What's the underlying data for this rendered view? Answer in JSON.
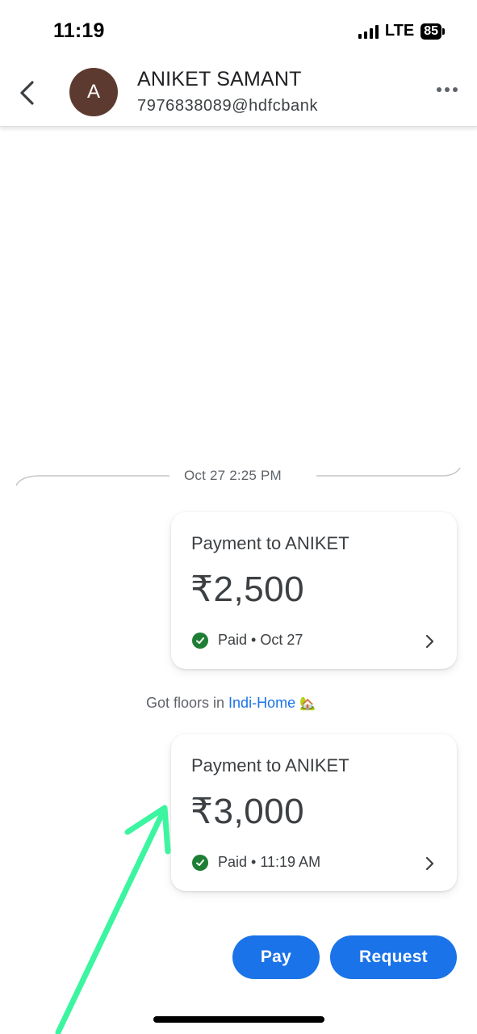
{
  "status_bar": {
    "time": "11:19",
    "network": "LTE",
    "battery": "85"
  },
  "header": {
    "avatar_letter": "A",
    "name": "ANIKET SAMANT",
    "upi_id": "7976838089@hdfcbank",
    "back_icon": "chevron-left-icon",
    "more_icon": "more-horizontal-icon"
  },
  "conversation": {
    "date_separator": "Oct 27 2:25 PM",
    "payments": [
      {
        "title": "Payment to ANIKET",
        "amount": "₹2,500",
        "status": "Paid",
        "detail": "Oct 27"
      },
      {
        "title": "Payment to ANIKET",
        "amount": "₹3,000",
        "status": "Paid",
        "detail": "11:19 AM"
      }
    ],
    "note": {
      "prefix": "Got floors in ",
      "link": "Indi-Home",
      "emoji": "🏡"
    }
  },
  "actions": {
    "pay_label": "Pay",
    "request_label": "Request"
  },
  "colors": {
    "accent": "#1a73e8",
    "success": "#1e7e34",
    "avatar": "#5d3a30",
    "annotation_arrow": "#3cf5a0"
  }
}
